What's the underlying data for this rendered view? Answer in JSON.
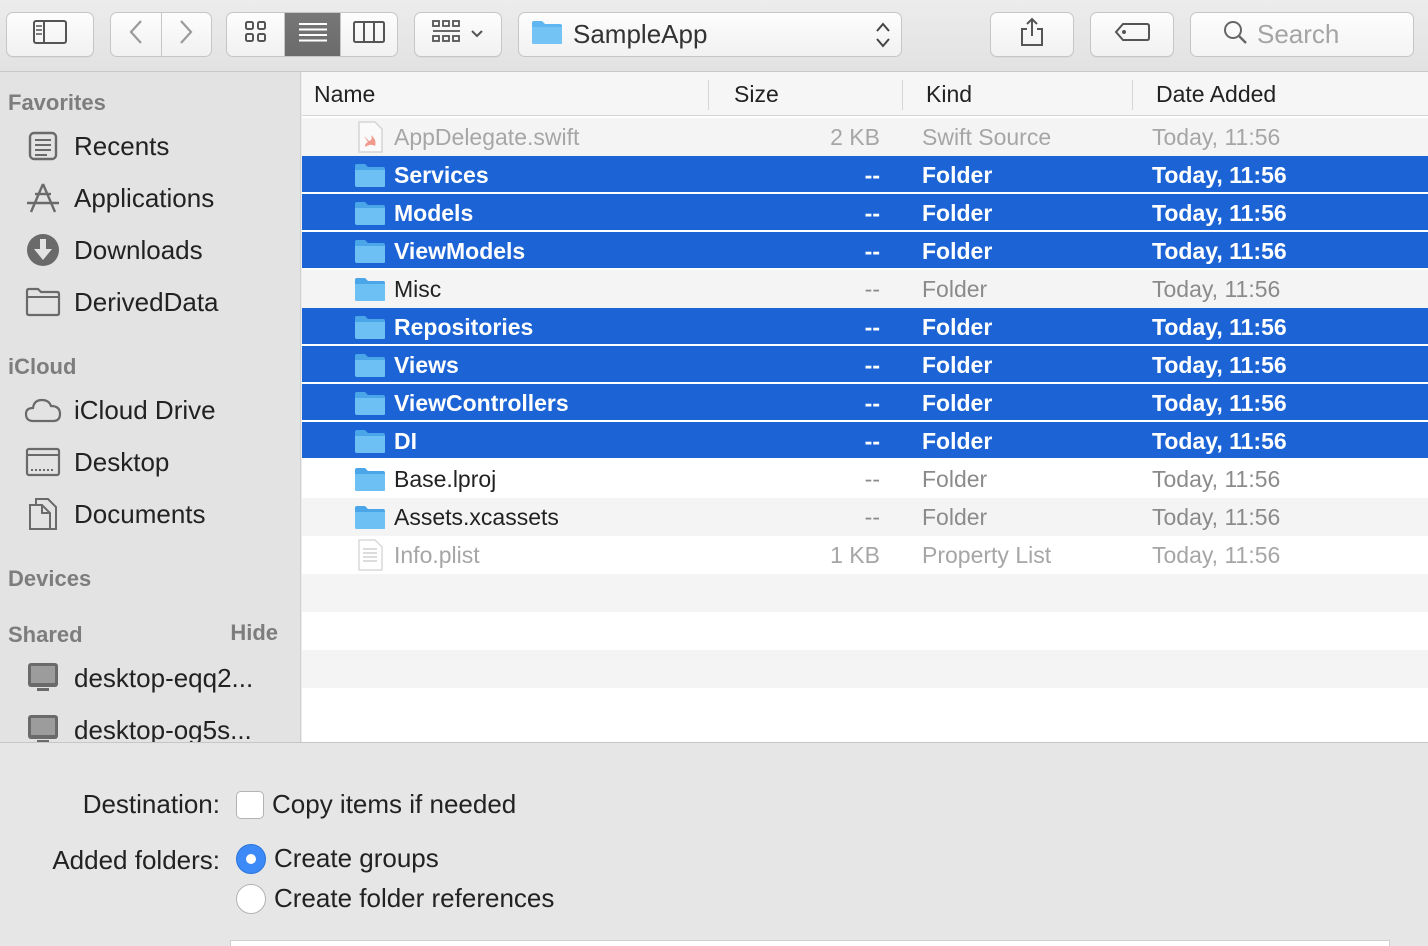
{
  "toolbar": {
    "path_label": "SampleApp",
    "search_placeholder": "Search"
  },
  "sidebar": {
    "favorites_header": "Favorites",
    "favorites": [
      {
        "label": "Recents",
        "icon": "recents-icon"
      },
      {
        "label": "Applications",
        "icon": "applications-icon"
      },
      {
        "label": "Downloads",
        "icon": "downloads-icon"
      },
      {
        "label": "DerivedData",
        "icon": "folder-icon"
      }
    ],
    "icloud_header": "iCloud",
    "icloud": [
      {
        "label": "iCloud Drive",
        "icon": "cloud-icon"
      },
      {
        "label": "Desktop",
        "icon": "desktop-icon"
      },
      {
        "label": "Documents",
        "icon": "documents-icon"
      }
    ],
    "devices_header": "Devices",
    "shared_header": "Shared",
    "shared_hide": "Hide",
    "shared": [
      {
        "label": "desktop-eqq2...",
        "icon": "computer-icon"
      },
      {
        "label": "desktop-og5s...",
        "icon": "computer-icon"
      }
    ]
  },
  "list": {
    "columns": {
      "name": "Name",
      "size": "Size",
      "kind": "Kind",
      "date": "Date Added"
    },
    "rows": [
      {
        "name": "AppDelegate.swift",
        "size": "2 KB",
        "kind": "Swift Source",
        "date": "Today, 11:56",
        "state": "disabled",
        "icon": "swift-file-icon"
      },
      {
        "name": "Services",
        "size": "--",
        "kind": "Folder",
        "date": "Today, 11:56",
        "state": "selected",
        "icon": "folder-icon"
      },
      {
        "name": "Models",
        "size": "--",
        "kind": "Folder",
        "date": "Today, 11:56",
        "state": "selected",
        "icon": "folder-icon"
      },
      {
        "name": "ViewModels",
        "size": "--",
        "kind": "Folder",
        "date": "Today, 11:56",
        "state": "selected",
        "icon": "folder-icon"
      },
      {
        "name": "Misc",
        "size": "--",
        "kind": "Folder",
        "date": "Today, 11:56",
        "state": "normal",
        "icon": "folder-icon"
      },
      {
        "name": "Repositories",
        "size": "--",
        "kind": "Folder",
        "date": "Today, 11:56",
        "state": "selected",
        "icon": "folder-icon"
      },
      {
        "name": "Views",
        "size": "--",
        "kind": "Folder",
        "date": "Today, 11:56",
        "state": "selected",
        "icon": "folder-icon"
      },
      {
        "name": "ViewControllers",
        "size": "--",
        "kind": "Folder",
        "date": "Today, 11:56",
        "state": "selected",
        "icon": "folder-icon"
      },
      {
        "name": "DI",
        "size": "--",
        "kind": "Folder",
        "date": "Today, 11:56",
        "state": "selected",
        "icon": "folder-icon"
      },
      {
        "name": "Base.lproj",
        "size": "--",
        "kind": "Folder",
        "date": "Today, 11:56",
        "state": "normal",
        "icon": "folder-icon"
      },
      {
        "name": "Assets.xcassets",
        "size": "--",
        "kind": "Folder",
        "date": "Today, 11:56",
        "state": "normal",
        "icon": "folder-icon"
      },
      {
        "name": "Info.plist",
        "size": "1 KB",
        "kind": "Property List",
        "date": "Today, 11:56",
        "state": "disabled",
        "icon": "plist-file-icon"
      }
    ]
  },
  "options": {
    "destination_label": "Destination:",
    "copy_items_label": "Copy items if needed",
    "copy_items_checked": false,
    "added_folders_label": "Added folders:",
    "create_groups_label": "Create groups",
    "create_folder_refs_label": "Create folder references",
    "selected_folder_option": "Create groups"
  },
  "colors": {
    "selection": "#1c64d5",
    "folder": "#5fb5ef",
    "radio_on": "#3b8af7"
  }
}
